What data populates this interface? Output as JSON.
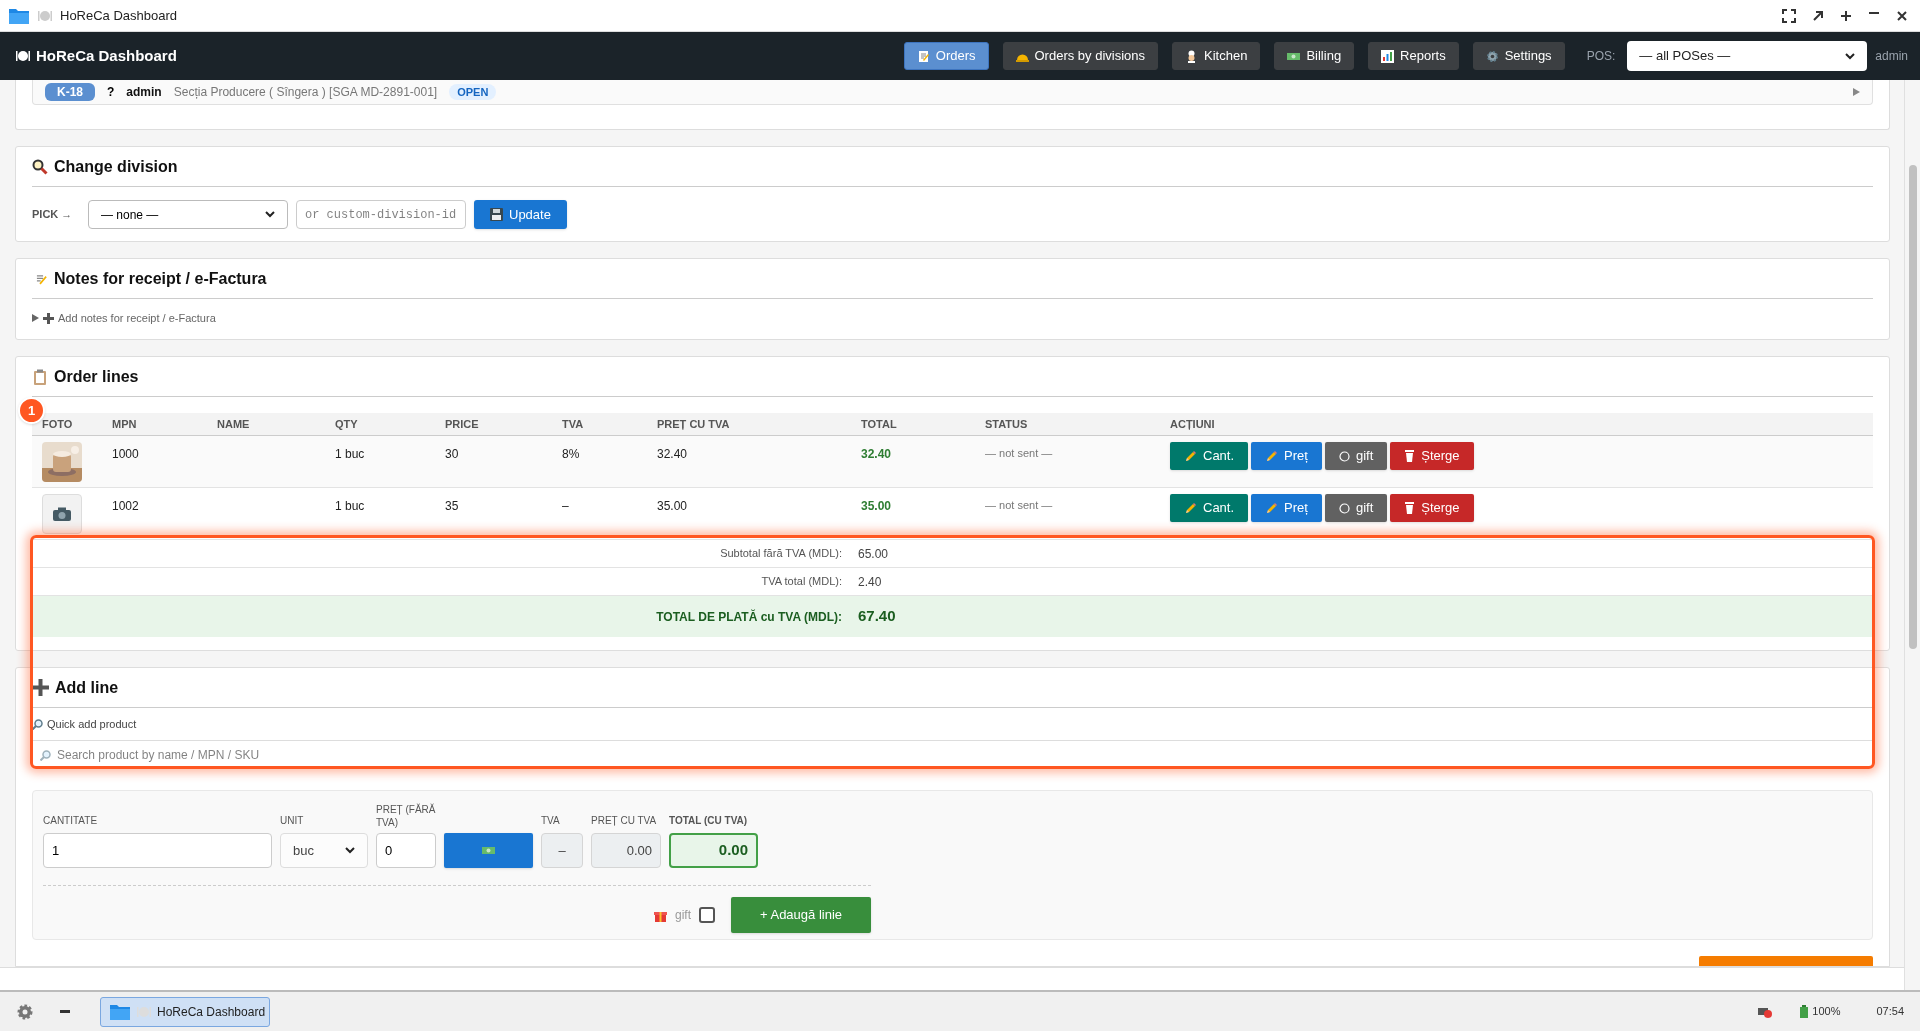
{
  "window": {
    "title": "HoReCa Dashboard"
  },
  "app_header": {
    "title": "HoReCa Dashboard",
    "nav": [
      {
        "label": "Orders",
        "selected": true
      },
      {
        "label": "Orders by divisions",
        "selected": false
      },
      {
        "label": "Kitchen",
        "selected": false
      },
      {
        "label": "Billing",
        "selected": false
      },
      {
        "label": "Reports",
        "selected": false
      },
      {
        "label": "Settings",
        "selected": false
      }
    ],
    "pos_label": "POS:",
    "pos_value": "— all POSes —",
    "user": "admin"
  },
  "order_summary": {
    "badge": "K-18",
    "mark": "?",
    "user": "admin",
    "division": "Secția Producere ( Sîngera ) [SGA MD-2891-001]",
    "status": "OPEN"
  },
  "change_division": {
    "title": "Change division",
    "pick_label": "PICK →",
    "select_value": "— none —",
    "custom_placeholder": "or custom-division-id",
    "button": "Update"
  },
  "notes": {
    "title": "Notes for receipt / e-Factura",
    "toggle": "Add notes for receipt / e-Factura",
    "expanded": false
  },
  "order_lines": {
    "title": "Order lines",
    "columns": [
      "FOTO",
      "MPN",
      "NAME",
      "QTY",
      "PRICE",
      "TVA",
      "PREȚ CU TVA",
      "TOTAL",
      "STATUS",
      "ACȚIUNI"
    ],
    "rows": [
      {
        "mpn": "1000",
        "qty": "1 buc",
        "price": "30",
        "tva": "8%",
        "pret_cu_tva": "32.40",
        "total": "32.40",
        "status": "— not sent —",
        "gift": false,
        "actions": [
          "Cant.",
          "Preț",
          "gift",
          "Șterge"
        ]
      },
      {
        "kind": "placeholder",
        "mpn": "1002",
        "qty": "1 buc",
        "price": "35",
        "tva": "–",
        "pret_cu_tva": "35.00",
        "total": "35.00",
        "status": "— not sent —",
        "gift": false,
        "actions": [
          "Cant.",
          "Preț",
          "gift",
          "Șterge"
        ]
      }
    ],
    "totals": [
      {
        "kind": "plain",
        "label": "Subtotal fără TVA (MDL):",
        "value": "65.00"
      },
      {
        "kind": "plain",
        "label": "TVA total (MDL):",
        "value": "2.40"
      },
      {
        "kind": "grand",
        "label": "TOTAL DE PLATĂ cu TVA (MDL):",
        "value": "67.40"
      }
    ]
  },
  "annotation": {
    "marker": "1"
  },
  "add_line": {
    "title": "Add line",
    "quick_label": "Quick add product",
    "search_placeholder": "Search product by name / MPN / SKU",
    "form": {
      "qty_label": "CANTITATE",
      "qty_value": "1",
      "unit_label": "UNIT",
      "unit_value": "buc",
      "price_label": "PREȚ (FĂRĂ TVA)",
      "price_value": "0",
      "tva_label": "TVA",
      "tva_value": "–",
      "pret_cu_tva_label": "PREȚ CU TVA",
      "pret_cu_tva_value": "0.00",
      "total_label": "TOTAL (CU TVA)",
      "total_value": "0.00",
      "gift_label": "gift",
      "gift_checked": false,
      "add_button": "+ Adaugă linie"
    }
  },
  "taskbar": {
    "task": "HoReCa Dashboard",
    "battery": "100%",
    "clock": "07:54"
  }
}
